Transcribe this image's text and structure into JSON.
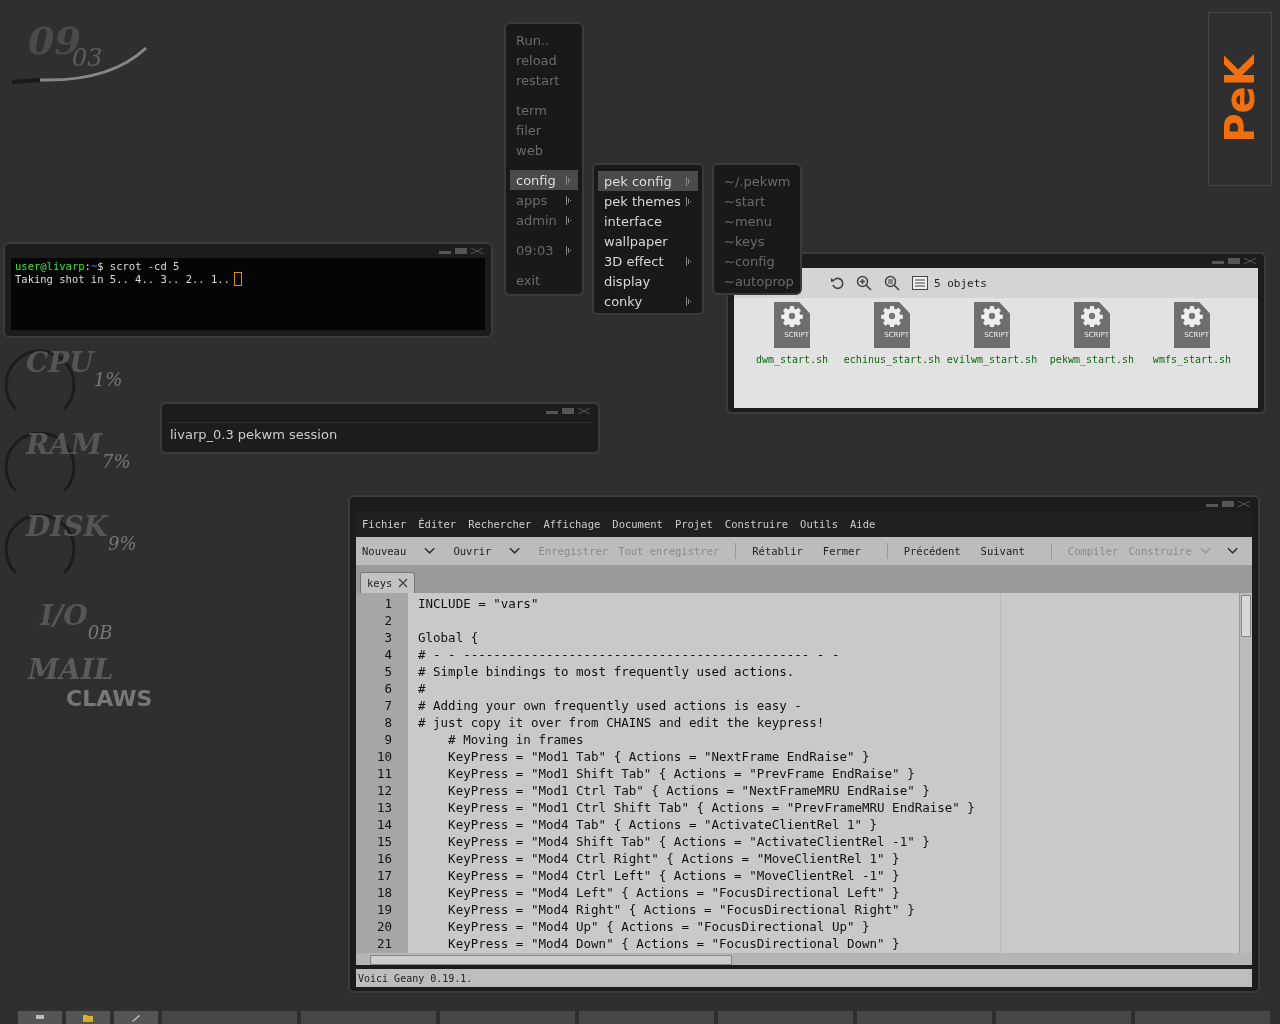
{
  "conky": {
    "clock": {
      "hours": "09",
      "minutes": "03"
    },
    "meters": [
      {
        "label": "CPU",
        "reading": "1%"
      },
      {
        "label": "RAM",
        "reading": "7%"
      },
      {
        "label": "DISK",
        "reading": "9%"
      }
    ],
    "io": {
      "label": "I/O",
      "reading": "0B"
    },
    "mail": {
      "label": "MAIL",
      "reading": "CLAWS"
    }
  },
  "logo": {
    "text": "PeK"
  },
  "root_menu": {
    "active": false,
    "groups": [
      [
        {
          "label": "Run..",
          "submenu": false,
          "selected": false
        },
        {
          "label": "reload",
          "submenu": false,
          "selected": false
        },
        {
          "label": "restart",
          "submenu": false,
          "selected": false
        }
      ],
      [
        {
          "label": "term",
          "submenu": false,
          "selected": false
        },
        {
          "label": "filer",
          "submenu": false,
          "selected": false
        },
        {
          "label": "web",
          "submenu": false,
          "selected": false
        }
      ],
      [
        {
          "label": "config",
          "submenu": true,
          "selected": true
        },
        {
          "label": "apps",
          "submenu": true,
          "selected": false
        },
        {
          "label": "admin",
          "submenu": true,
          "selected": false
        }
      ],
      [
        {
          "label": "09:03",
          "submenu": true,
          "selected": false
        }
      ],
      [
        {
          "label": "exit",
          "submenu": false,
          "selected": false
        }
      ]
    ]
  },
  "config_menu": {
    "active": true,
    "groups": [
      [
        {
          "label": "pek config",
          "submenu": true,
          "selected": true
        },
        {
          "label": "pek themes",
          "submenu": true,
          "selected": false
        },
        {
          "label": "interface",
          "submenu": false,
          "selected": false
        },
        {
          "label": "wallpaper",
          "submenu": false,
          "selected": false
        },
        {
          "label": "3D effect",
          "submenu": true,
          "selected": false
        },
        {
          "label": "display",
          "submenu": false,
          "selected": false
        },
        {
          "label": "conky",
          "submenu": true,
          "selected": false
        }
      ]
    ]
  },
  "pek_config_menu": {
    "active": false,
    "groups": [
      [
        {
          "label": "~/.pekwm",
          "submenu": false,
          "selected": false
        },
        {
          "label": "~start",
          "submenu": false,
          "selected": false
        },
        {
          "label": "~menu",
          "submenu": false,
          "selected": false
        },
        {
          "label": "~keys",
          "submenu": false,
          "selected": false
        },
        {
          "label": "~config",
          "submenu": false,
          "selected": false
        },
        {
          "label": "~autoprop",
          "submenu": false,
          "selected": false
        }
      ]
    ]
  },
  "terminal": {
    "user": "user@livarp",
    "separator": ":",
    "cwd": "~",
    "command": "$ scrot -cd 5",
    "output": "Taking shot in 5.. 4.. 3.. 2.. 1.."
  },
  "session_window": {
    "text": "livarp_0.3 pekwm session"
  },
  "file_manager": {
    "count": "5 objets",
    "files": [
      {
        "name": "dwm_start.sh",
        "badge": "SCRIPT"
      },
      {
        "name": "echinus_start.sh",
        "badge": "SCRIPT"
      },
      {
        "name": "evilwm_start.sh",
        "badge": "SCRIPT"
      },
      {
        "name": "pekwm_start.sh",
        "badge": "SCRIPT"
      },
      {
        "name": "wmfs_start.sh",
        "badge": "SCRIPT"
      }
    ]
  },
  "editor": {
    "menu": [
      "Fichier",
      "Éditer",
      "Rechercher",
      "Affichage",
      "Document",
      "Projet",
      "Construire",
      "Outils",
      "Aide"
    ],
    "toolbar": [
      {
        "kind": "button",
        "label": "Nouveau",
        "disabled": false
      },
      {
        "kind": "dropdown",
        "disabled": false
      },
      {
        "kind": "button",
        "label": "Ouvrir",
        "disabled": false
      },
      {
        "kind": "dropdown",
        "disabled": false
      },
      {
        "kind": "button",
        "label": "Enregistrer",
        "disabled": true
      },
      {
        "kind": "button",
        "label": "Tout enregistrer",
        "disabled": true
      },
      {
        "kind": "separator"
      },
      {
        "kind": "button",
        "label": "Rétablir",
        "disabled": false
      },
      {
        "kind": "button",
        "label": "Fermer",
        "disabled": false
      },
      {
        "kind": "separator"
      },
      {
        "kind": "button",
        "label": "Précédent",
        "disabled": false
      },
      {
        "kind": "button",
        "label": "Suivant",
        "disabled": false
      },
      {
        "kind": "separator"
      },
      {
        "kind": "button",
        "label": "Compiler",
        "disabled": true
      },
      {
        "kind": "button",
        "label": "Construire",
        "disabled": true
      },
      {
        "kind": "dropdown",
        "disabled": true
      },
      {
        "kind": "dropdown",
        "disabled": false
      }
    ],
    "tabs": [
      {
        "label": "keys",
        "selected": true
      }
    ],
    "lines": [
      {
        "number": "1",
        "code": "INCLUDE = \"vars\""
      },
      {
        "number": "2"
      },
      {
        "number": "3",
        "code": "Global {"
      },
      {
        "number": "4",
        "code": "# - - ---------------------------------------------- - -"
      },
      {
        "number": "5",
        "code": "# Simple bindings to most frequently used actions."
      },
      {
        "number": "6",
        "code": "#"
      },
      {
        "number": "7",
        "code": "# Adding your own frequently used actions is easy -"
      },
      {
        "number": "8",
        "code": "# just copy it over from CHAINS and edit the keypress!"
      },
      {
        "number": "9",
        "code": "    # Moving in frames"
      },
      {
        "number": "10",
        "code": "    KeyPress = \"Mod1 Tab\" { Actions = \"NextFrame EndRaise\" }"
      },
      {
        "number": "11",
        "code": "    KeyPress = \"Mod1 Shift Tab\" { Actions = \"PrevFrame EndRaise\" }"
      },
      {
        "number": "12",
        "code": "    KeyPress = \"Mod1 Ctrl Tab\" { Actions = \"NextFrameMRU EndRaise\" }"
      },
      {
        "number": "13",
        "code": "    KeyPress = \"Mod1 Ctrl Shift Tab\" { Actions = \"PrevFrameMRU EndRaise\" }"
      },
      {
        "number": "14",
        "code": "    KeyPress = \"Mod4 Tab\" { Actions = \"ActivateClientRel 1\" }"
      },
      {
        "number": "15",
        "code": "    KeyPress = \"Mod4 Shift Tab\" { Actions = \"ActivateClientRel -1\" }"
      },
      {
        "number": "16",
        "code": "    KeyPress = \"Mod4 Ctrl Right\" { Actions = \"MoveClientRel 1\" }"
      },
      {
        "number": "17",
        "code": "    KeyPress = \"Mod4 Ctrl Left\" { Actions = \"MoveClientRel -1\" }"
      },
      {
        "number": "18",
        "code": "    KeyPress = \"Mod4 Left\" { Actions = \"FocusDirectional Left\" }"
      },
      {
        "number": "19",
        "code": "    KeyPress = \"Mod4 Right\" { Actions = \"FocusDirectional Right\" }"
      },
      {
        "number": "20",
        "code": "    KeyPress = \"Mod4 Up\" { Actions = \"FocusDirectional Up\" }"
      },
      {
        "number": "21",
        "code": "    KeyPress = \"Mod4 Down\" { Actions = \"FocusDirectional Down\" }"
      }
    ],
    "status": "Voici Geany 0.19.1."
  },
  "taskbar": {
    "launchers": [
      {
        "kind": "monitor"
      },
      {
        "kind": "folder"
      },
      {
        "kind": "pencil"
      }
    ]
  }
}
